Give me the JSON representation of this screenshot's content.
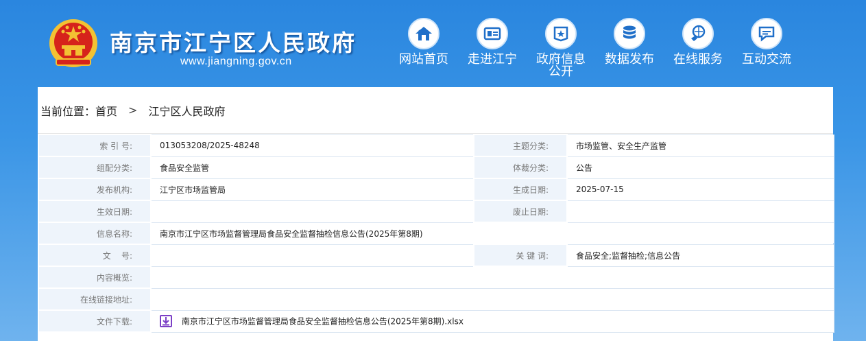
{
  "header": {
    "site_title": "南京市江宁区人民政府",
    "site_url": "www.jiangning.gov.cn"
  },
  "nav": [
    {
      "label": "网站首页",
      "icon": "home-icon"
    },
    {
      "label": "走进江宁",
      "icon": "intro-card-icon"
    },
    {
      "label": "政府信息公开",
      "icon": "open-info-icon"
    },
    {
      "label": "数据发布",
      "icon": "database-icon"
    },
    {
      "label": "在线服务",
      "icon": "online-service-icon"
    },
    {
      "label": "互动交流",
      "icon": "chat-icon"
    }
  ],
  "breadcrumb": {
    "prefix": "当前位置：",
    "home": "首页",
    "separator": ">",
    "current": "江宁区人民政府"
  },
  "meta": {
    "index_label": "索 引 号:",
    "index_value": "013053208/2025-48248",
    "topic_label": "主题分类:",
    "topic_value": "市场监管、安全生产监管",
    "org_cat_label": "组配分类:",
    "org_cat_value": "食品安全监管",
    "genre_label": "体裁分类:",
    "genre_value": "公告",
    "publisher_label": "发布机构:",
    "publisher_value": "江宁区市场监管局",
    "created_label": "生成日期:",
    "created_value": "2025-07-15",
    "effective_label": "生效日期:",
    "effective_value": "",
    "abolished_label": "废止日期:",
    "abolished_value": "",
    "name_label": "信息名称:",
    "name_value": "南京市江宁区市场监督管理局食品安全监督抽检信息公告(2025年第8期)",
    "docno_label": "文    号:",
    "docno_value": "",
    "keywords_label": "关 键 词:",
    "keywords_value": "食品安全;监督抽检;信息公告",
    "summary_label": "内容概览:",
    "summary_value": "",
    "link_label": "在线链接地址:",
    "link_value": "",
    "download_label": "文件下载:",
    "download_value": "南京市江宁区市场监督管理局食品安全监督抽检信息公告(2025年第8期).xlsx"
  },
  "colors": {
    "header_blue": "#2a86df",
    "label_bg": "#eef4fb",
    "download_icon": "#7b3fc6",
    "emblem_red": "#d6231b",
    "emblem_gold": "#f3c233"
  }
}
